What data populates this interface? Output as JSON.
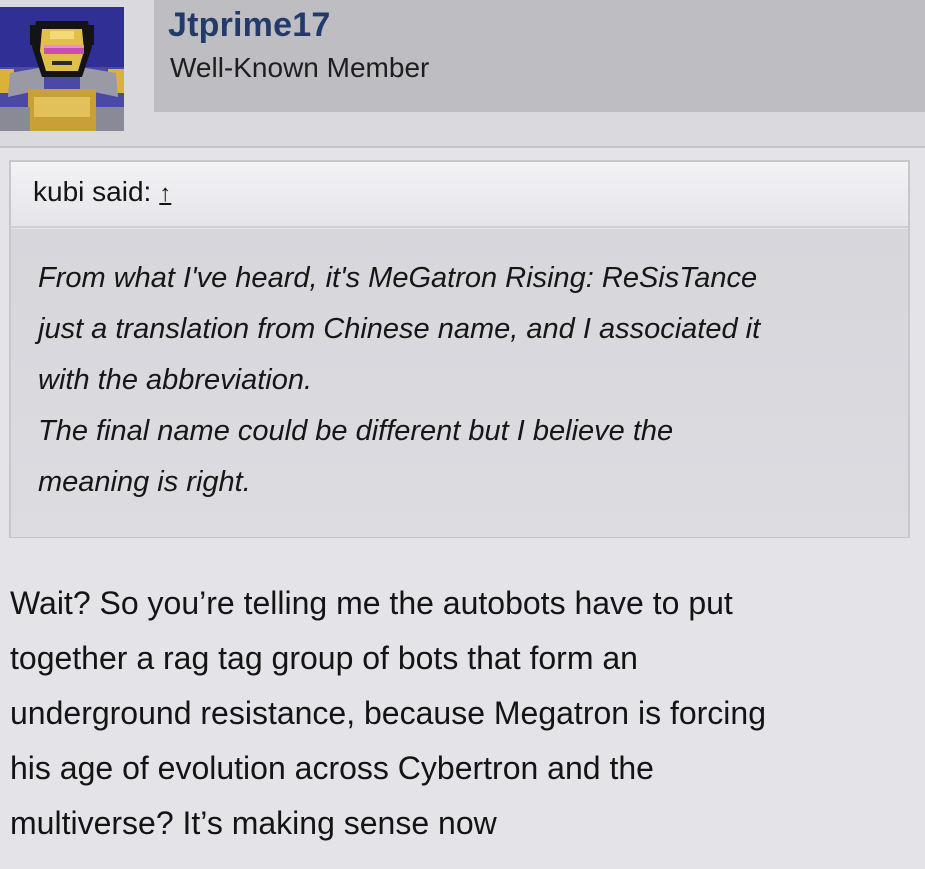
{
  "post": {
    "author": {
      "username": "Jtprime17",
      "title": "Well-Known Member",
      "avatar_icon": "transformer-robot-avatar"
    },
    "quote": {
      "attribution": "kubi said:",
      "jump_glyph": "↑",
      "lines": [
        "From what I've heard, it's MeGatron Rising: ReSisTance",
        "just a translation from Chinese name, and I associated it",
        "with the abbreviation.",
        "The final name could be different but I believe the",
        "meaning is right."
      ]
    },
    "message": {
      "lines": [
        "Wait? So you’re telling me the autobots have to put",
        "together a rag tag group of bots that form an",
        "underground resistance, because Megatron is forcing",
        "his age of evolution across Cybertron and the",
        "multiverse? It’s making sense now"
      ]
    }
  },
  "colors": {
    "background": "#e3e3e8",
    "username": "#233a6b",
    "user_block": "#bdbdc2",
    "quote_body": "#d6d6db"
  }
}
